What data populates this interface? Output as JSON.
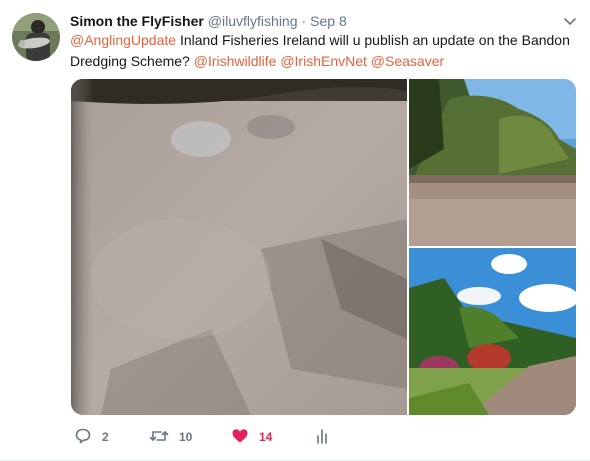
{
  "tweet": {
    "author_name": "Simon the FlyFisher",
    "author_handle": "@iluvflyfishing",
    "separator": "·",
    "timestamp": "Sep 8",
    "text_parts": {
      "mention_1": "@AnglingUpdate",
      "body": " Inland Fisheries Ireland will u publish an update on the Bandon Dredging Scheme? ",
      "mention_2": "@Irishwildlife",
      "mention_3": "@IrishEnvNet",
      "mention_4": "@Seasaver"
    },
    "actions": {
      "reply_count": "2",
      "retweet_count": "10",
      "like_count": "14"
    }
  },
  "icons": {
    "caret": "chevron-down-icon",
    "reply": "comment-bubble-icon",
    "retweet": "retweet-arrows-icon",
    "like": "heart-icon",
    "analytics": "bar-chart-icon"
  },
  "colors": {
    "mention": "#e8613a",
    "like_active": "#e0245e",
    "secondary_text": "#657786"
  }
}
